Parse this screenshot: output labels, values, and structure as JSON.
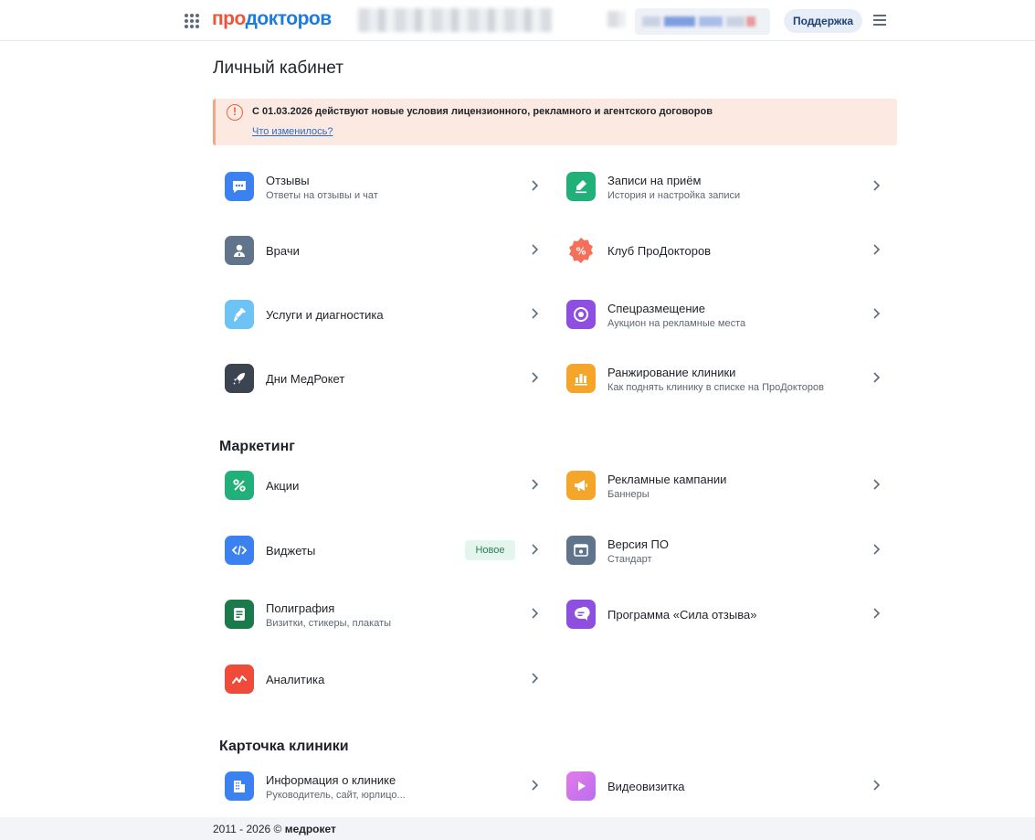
{
  "header": {
    "logo_part1": "про",
    "logo_part2": "докторов",
    "support_label": "Поддержка"
  },
  "page": {
    "title": "Личный кабинет"
  },
  "notice": {
    "text": "С 01.03.2026 действуют новые условия лицензионного, рекламного и агентского договоров",
    "link": "Что изменилось?"
  },
  "main_items": [
    {
      "title": "Отзывы",
      "subtitle": "Ответы на отзывы и чат",
      "icon": "chat-bubble-icon",
      "color": "#3b82f0"
    },
    {
      "title": "Записи на приём",
      "subtitle": "История и настройка записи",
      "icon": "edit-pen-icon",
      "color": "#22b07a"
    },
    {
      "title": "Врачи",
      "subtitle": "",
      "icon": "doctor-icon",
      "color": "#60758c"
    },
    {
      "title": "Клуб ПроДокторов",
      "subtitle": "",
      "icon": "percent-badge-icon",
      "color": "#f4705a"
    },
    {
      "title": "Услуги и диагностика",
      "subtitle": "",
      "icon": "syringe-icon",
      "color": "#6cc3f4"
    },
    {
      "title": "Спецразмещение",
      "subtitle": "Аукцион на рекламные места",
      "icon": "target-icon",
      "color": "#8e4fe0"
    },
    {
      "title": "Дни МедРокет",
      "subtitle": "",
      "icon": "rocket-icon",
      "color": "#3c4452"
    },
    {
      "title": "Ранжирование клиники",
      "subtitle": "Как поднять клинику в списке на ПроДокторов",
      "icon": "bar-chart-icon",
      "color": "#f4a52a"
    }
  ],
  "marketing": {
    "title": "Маркетинг",
    "items": [
      {
        "title": "Акции",
        "subtitle": "",
        "icon": "percent-icon",
        "color": "#22b07a"
      },
      {
        "title": "Рекламные кампании",
        "subtitle": "Баннеры",
        "icon": "megaphone-icon",
        "color": "#f4a52a"
      },
      {
        "title": "Виджеты",
        "subtitle": "",
        "icon": "code-icon",
        "color": "#3b82f0",
        "badge": "Новое"
      },
      {
        "title": "Версия ПО",
        "subtitle": "Стандарт",
        "icon": "software-window-icon",
        "color": "#60758c"
      },
      {
        "title": "Полиграфия",
        "subtitle": "Визитки, стикеры, плакаты",
        "icon": "document-icon",
        "color": "#1a7a4c"
      },
      {
        "title": "Программа «Сила отзыва»",
        "subtitle": "",
        "icon": "review-chat-icon",
        "color": "#8e4fe0"
      },
      {
        "title": "Аналитика",
        "subtitle": "",
        "icon": "analytics-line-icon",
        "color": "#f04a3a"
      }
    ]
  },
  "clinic_card": {
    "title": "Карточка клиники",
    "items": [
      {
        "title": "Информация о клинике",
        "subtitle": "Руководитель, сайт, юрлицо...",
        "icon": "building-icon",
        "color": "#3b82f0"
      },
      {
        "title": "Видеовизитка",
        "subtitle": "",
        "icon": "play-icon",
        "color": "#d86ee8"
      }
    ]
  },
  "footer": {
    "years": "2011 - 2026 ©",
    "brand": "медрокет"
  }
}
